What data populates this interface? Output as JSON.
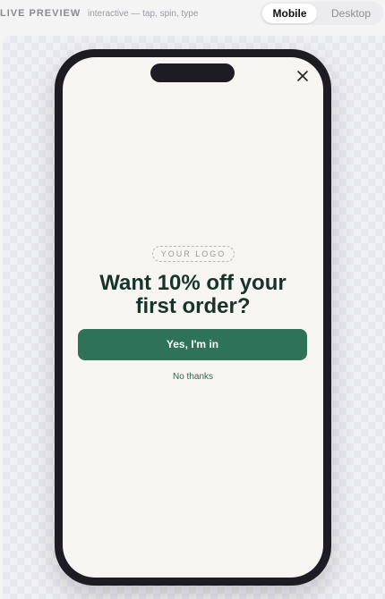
{
  "header": {
    "live_label": "LIVE PREVIEW",
    "hint": "interactive — tap, spin, type",
    "view_toggle": {
      "options": [
        "Mobile",
        "Desktop"
      ],
      "selected": "Mobile"
    }
  },
  "popup": {
    "logo_placeholder": "YOUR LOGO",
    "headline_line1": "Want 10% off your",
    "headline_line2": "first order?",
    "cta_label": "Yes, I'm in",
    "decline_label": "No thanks",
    "close_icon": "close-icon"
  },
  "colors": {
    "accent": "#2e7259",
    "headline": "#17332a",
    "screen_bg": "#f6f5f1",
    "phone_frame": "#1d1c22"
  }
}
